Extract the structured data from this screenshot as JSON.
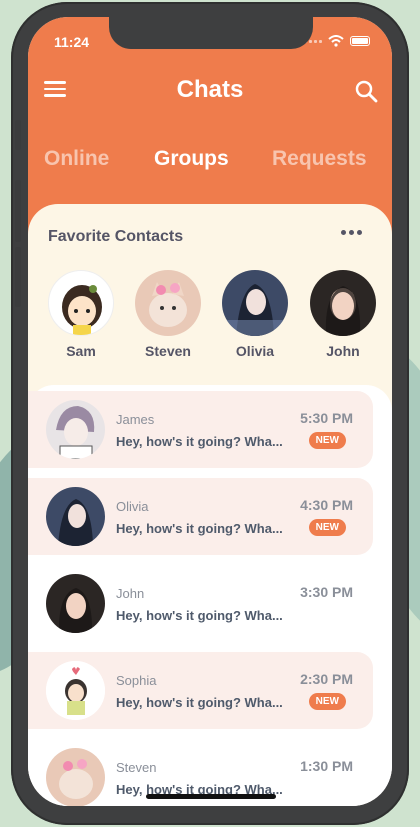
{
  "status_bar": {
    "time": "11:24"
  },
  "header": {
    "title": "Chats"
  },
  "tabs": [
    {
      "label": "Online",
      "active": false
    },
    {
      "label": "Groups",
      "active": true
    },
    {
      "label": "Requests",
      "active": false
    }
  ],
  "favorites": {
    "title": "Favorite Contacts",
    "contacts": [
      {
        "name": "Sam"
      },
      {
        "name": "Steven"
      },
      {
        "name": "Olivia"
      },
      {
        "name": "John"
      }
    ]
  },
  "chats": [
    {
      "name": "James",
      "message": "Hey, how's it going? Wha...",
      "time": "5:30 PM",
      "badge": "NEW",
      "unread": true
    },
    {
      "name": "Olivia",
      "message": "Hey, how's it going? Wha...",
      "time": "4:30 PM",
      "badge": "NEW",
      "unread": true
    },
    {
      "name": "John",
      "message": "Hey, how's it going? Wha...",
      "time": "3:30 PM",
      "badge": "",
      "unread": false
    },
    {
      "name": "Sophia",
      "message": "Hey, how's it going? Wha...",
      "time": "2:30 PM",
      "badge": "NEW",
      "unread": true
    },
    {
      "name": "Steven",
      "message": "Hey, how's it going? Wha...",
      "time": "1:30 PM",
      "badge": "",
      "unread": false
    }
  ],
  "colors": {
    "accent": "#ef7c4c",
    "background": "#fdf6e6",
    "unread_row": "#fbeeea"
  }
}
